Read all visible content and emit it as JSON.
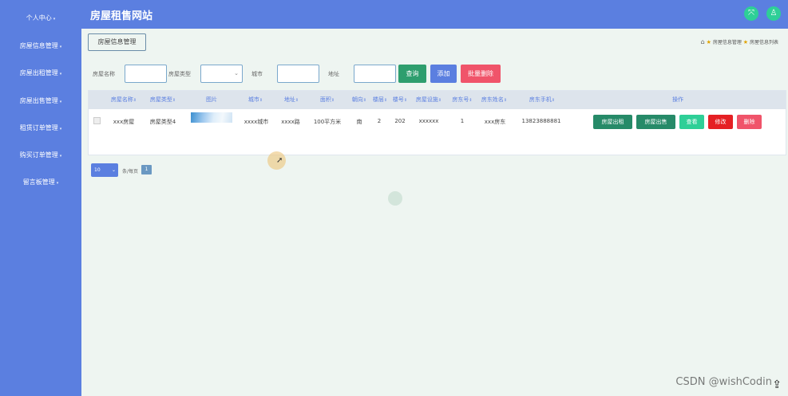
{
  "app": {
    "title": "房屋租售网站"
  },
  "sidebar": {
    "items": [
      {
        "label": "个人中心"
      },
      {
        "label": "房屋信息管理"
      },
      {
        "label": "房屋出租管理"
      },
      {
        "label": "房屋出售管理"
      },
      {
        "label": "租赁订单管理"
      },
      {
        "label": "购买订单管理"
      },
      {
        "label": "留言板管理"
      }
    ],
    "arrow": "▾"
  },
  "header": {
    "icon_left": "⤧",
    "icon_right": "♙"
  },
  "breadcrumb": {
    "button_label": "房屋信息管理",
    "home_icon": "⌂",
    "star": "★",
    "path": [
      "房屋信息管理",
      "房屋信息列表"
    ]
  },
  "search": {
    "name_label": "房屋名称",
    "type_label": "房屋类型",
    "city_label": "城市",
    "address_label": "地址",
    "select_caret": "⌄",
    "buttons": {
      "query": "查询",
      "add": "添加",
      "batch_delete": "批量删除"
    }
  },
  "table": {
    "sort_glyph": "⇕",
    "headers": [
      "房屋名称",
      "房屋类型",
      "图片",
      "城市",
      "地址",
      "面积",
      "朝向",
      "楼层",
      "楼号",
      "房屋设施",
      "房东号",
      "房东姓名",
      "房东手机",
      "操作"
    ],
    "row": [
      "xxx房屋",
      "房屋类型4",
      "",
      "xxxx城市",
      "xxxx路",
      "100平方米",
      "南",
      "2",
      "202",
      "xxxxxx",
      "1",
      "xxx房东",
      "13823888881"
    ],
    "actions": {
      "rent": "房屋出租",
      "sell": "房屋出售",
      "view": "查看",
      "edit": "修改",
      "delete": "删除"
    }
  },
  "pagination": {
    "page_size": "10",
    "caret": "⌄",
    "per_page_label": "条/每页",
    "current_page": "1"
  },
  "watermark": "CSDN @wishCodin",
  "scroll_top_icon": "⇪",
  "cursor_icon": "➚"
}
